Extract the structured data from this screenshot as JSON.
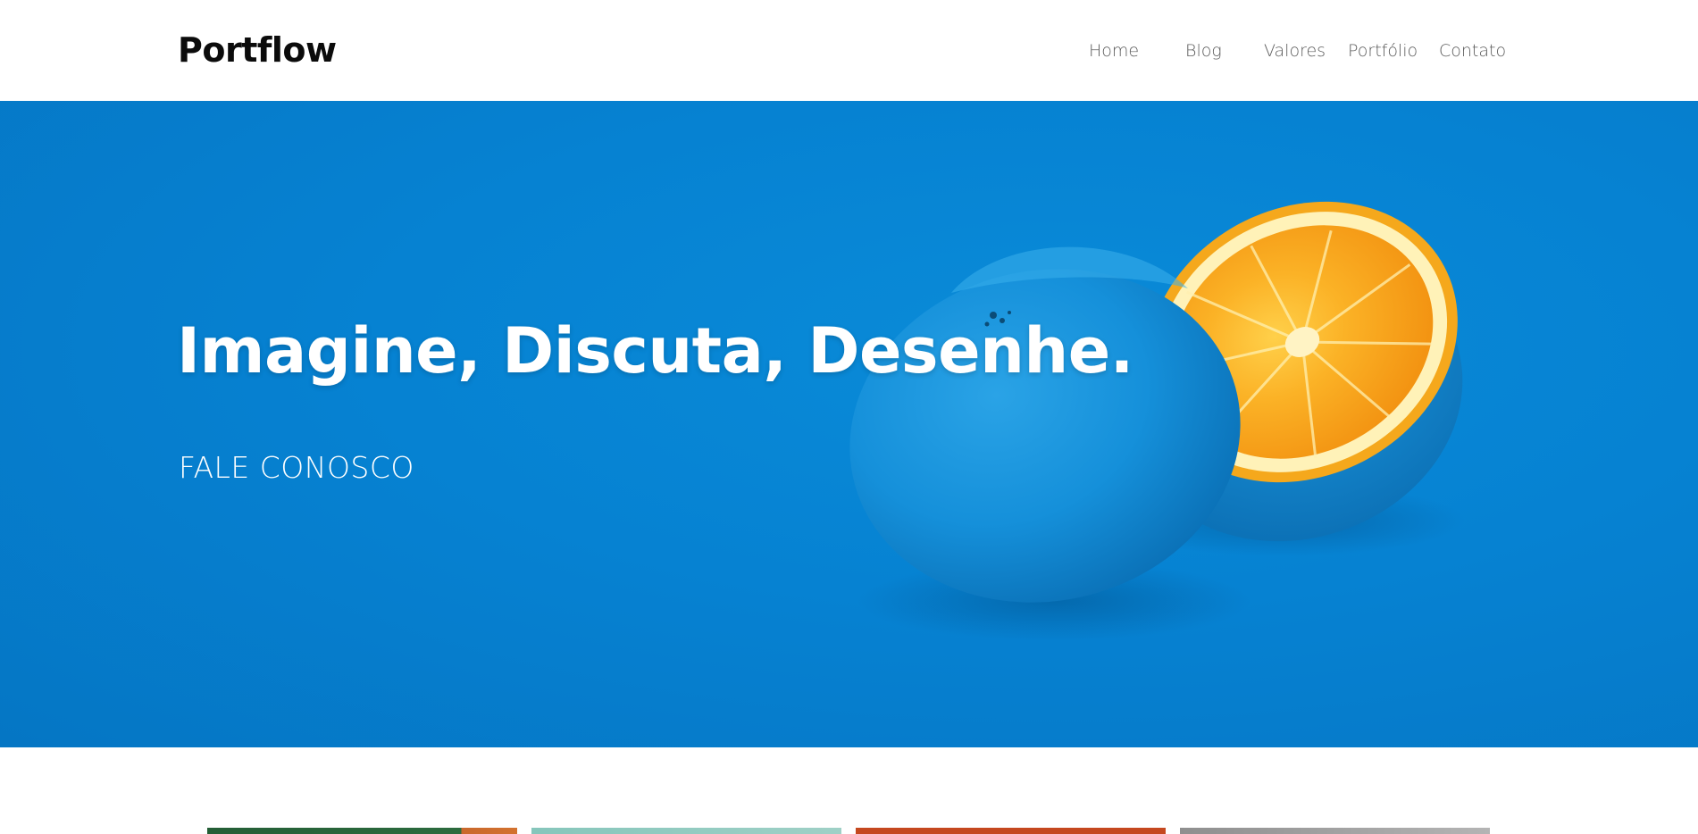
{
  "header": {
    "logo": "Portflow",
    "nav": [
      {
        "label": "Home"
      },
      {
        "label": "Blog"
      },
      {
        "label": "Valores"
      },
      {
        "label": "Portfólio"
      },
      {
        "label": "Contato"
      }
    ]
  },
  "hero": {
    "title": "Imagine, Discuta, Desenhe.",
    "cta": "FALE CONOSCO",
    "image": "blue-painted-orange-halves"
  },
  "portfolio": {
    "thumbnails": [
      {
        "name": "portfolio-thumb-green-orange"
      },
      {
        "name": "portfolio-thumb-mint"
      },
      {
        "name": "portfolio-thumb-red"
      },
      {
        "name": "portfolio-thumb-gray"
      }
    ]
  },
  "colors": {
    "hero_blue": "#0682d2",
    "orange_flesh": "#f7a21b",
    "text_dark": "#0b0b0b",
    "nav_text": "#5c5c5c"
  }
}
